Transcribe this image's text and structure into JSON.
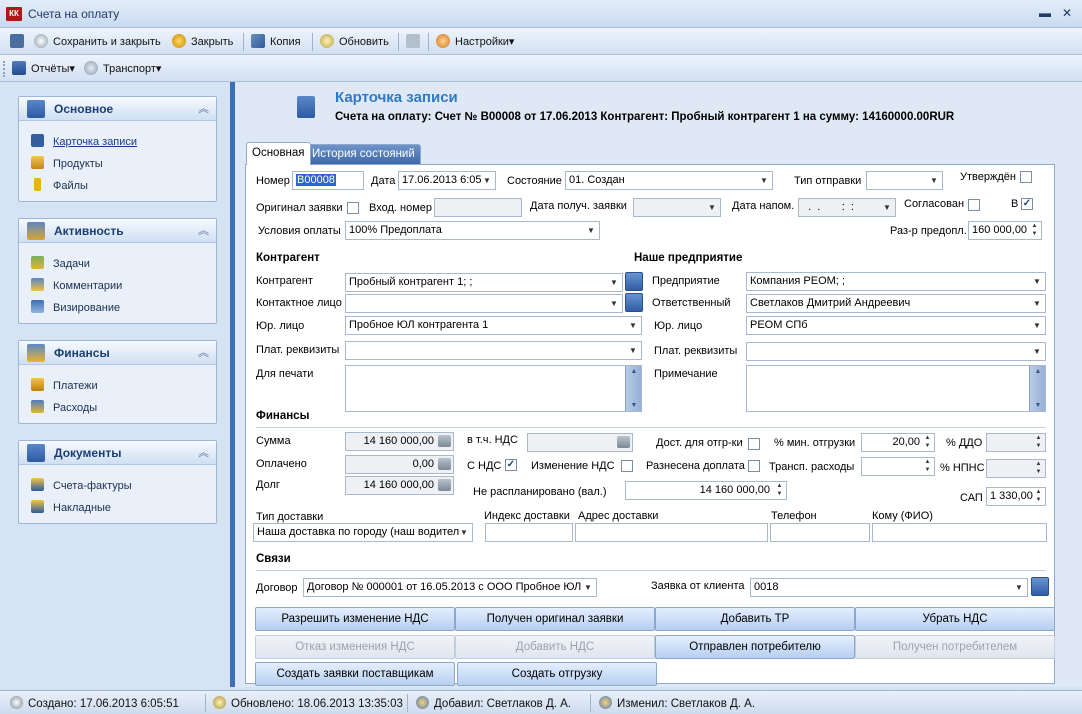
{
  "window": {
    "title": "Счета на оплату",
    "app_badge": "КК",
    "minimize_glyph": "▬",
    "close_glyph": "✕"
  },
  "toolbar1": {
    "save_close": "Сохранить и закрыть",
    "close": "Закрыть",
    "copy": "Копия",
    "refresh": "Обновить",
    "settings": "Настройки▾"
  },
  "toolbar2": {
    "reports": "Отчёты▾",
    "transport": "Транспорт▾"
  },
  "nav": {
    "groups": [
      {
        "title": "Основное",
        "items": [
          "Карточка записи",
          "Продукты",
          "Файлы"
        ]
      },
      {
        "title": "Активность",
        "items": [
          "Задачи",
          "Комментарии",
          "Визирование"
        ]
      },
      {
        "title": "Финансы",
        "items": [
          "Платежи",
          "Расходы"
        ]
      },
      {
        "title": "Документы",
        "items": [
          "Счета-фактуры",
          "Накладные"
        ]
      }
    ],
    "collapse_glyph": "︽"
  },
  "card": {
    "title": "Карточка записи",
    "subtitle": "Счета на оплату: Счет № В00008 от 17.06.2013 Контрагент: Пробный контрагент 1 на сумму: 14160000.00RUR"
  },
  "tabs": {
    "main": "Основная",
    "history": "История состояний"
  },
  "form": {
    "number_label": "Номер",
    "number_value": "В00008",
    "date_label": "Дата",
    "date_value": "17.06.2013 6:05",
    "state_label": "Состояние",
    "state_value": "01. Создан",
    "send_type_label": "Тип отправки",
    "send_type_value": "",
    "approved_label": "Утверждён",
    "orig_request_label": "Оригинал заявки",
    "incoming_no_label": "Вход. номер",
    "incoming_no_value": "",
    "recv_date_label": "Дата получ. заявки",
    "recv_date_value": "",
    "reminder_date_label": "Дата напом.",
    "reminder_date_value": "  .  .       :  :",
    "agreed_label": "Согласован",
    "v_label": "В",
    "payment_terms_label": "Условия оплаты",
    "payment_terms_value": "100% Предоплата",
    "prepay_label": "Раз-р предопл.",
    "prepay_value": "160 000,00",
    "counterparty_section": "Контрагент",
    "our_company_section": "Наше предприятие",
    "counterparty_label": "Контрагент",
    "counterparty_value": "Пробный контрагент 1; ;",
    "contact_label": "Контактное лицо",
    "contact_value": "",
    "legal_left_label": "Юр. лицо",
    "legal_left_value": "Пробное ЮЛ контрагента 1",
    "pay_req_left_label": "Плат. реквизиты",
    "pay_req_left_value": "",
    "for_print_label": "Для печати",
    "company_label": "Предприятие",
    "company_value": "Компания РЕОМ; ;",
    "responsible_label": "Ответственный",
    "responsible_value": "Светлаков Дмитрий Андреевич",
    "legal_right_label": "Юр. лицо",
    "legal_right_value": "РЕОМ СПб",
    "pay_req_right_label": "Плат. реквизиты",
    "pay_req_right_value": "",
    "note_label": "Примечание",
    "finance_section": "Финансы",
    "sum_label": "Сумма",
    "sum_value": "14 160 000,00",
    "paid_label": "Оплачено",
    "paid_value": "0,00",
    "debt_label": "Долг",
    "debt_value": "14 160 000,00",
    "vat_incl_label": "в т.ч. НДС",
    "vat_incl_value": "",
    "with_vat_label": "С НДС",
    "vat_change_label": "Изменение НДС",
    "unplanned_label": "Не распланировано (вал.)",
    "unplanned_value": "14 160 000,00",
    "ship_allowed_label": "Дост. для отгр-ки",
    "surcharge_label": "Разнесена доплата",
    "min_ship_label": "% мин. отгрузки",
    "min_ship_value": "20,00",
    "transport_cost_label": "Трансп. расходы",
    "transport_cost_value": "",
    "ddo_label": "% ДДО",
    "ddo_value": "",
    "npns_label": "% НПНС",
    "npns_value": "",
    "sap_label": "САП",
    "sap_value": "1 330,00",
    "delivery_type_label": "Тип доставки",
    "delivery_type_value": "Наша доставка по городу (наш водител",
    "postcode_label": "Индекс доставки",
    "postcode_value": "",
    "address_label": "Адрес доставки",
    "address_value": "",
    "phone_label": "Телефон",
    "phone_value": "",
    "recipient_label": "Кому (ФИО)",
    "recipient_value": "",
    "links_section": "Связи",
    "contract_label": "Договор",
    "contract_value": "Договор № 000001 от 16.05.2013  с ООО Пробное ЮЛ",
    "client_request_label": "Заявка от клиента",
    "client_request_value": "0018"
  },
  "actions": {
    "allow_vat_change": "Разрешить изменение НДС",
    "orig_received": "Получен оригинал заявки",
    "add_tr": "Добавить ТР",
    "remove_vat": "Убрать НДС",
    "deny_vat_change": "Отказ изменения НДС",
    "add_vat": "Добавить НДС",
    "sent_to_consumer": "Отправлен потребителю",
    "received_by_consumer": "Получен потребителем",
    "create_supplier_requests": "Создать заявки поставщикам",
    "create_shipment": "Создать отгрузку"
  },
  "status": {
    "created": "Создано: 17.06.2013 6:05:51",
    "updated": "Обновлено: 18.06.2013 13:35:03",
    "added_by": "Добавил: Светлаков Д. А.",
    "changed_by": "Изменил: Светлаков Д. А."
  },
  "colors": {
    "accent_blue": "#2f79c9",
    "splitter": "#3c6fb8",
    "tab_active_bg": "#3d69ac"
  }
}
